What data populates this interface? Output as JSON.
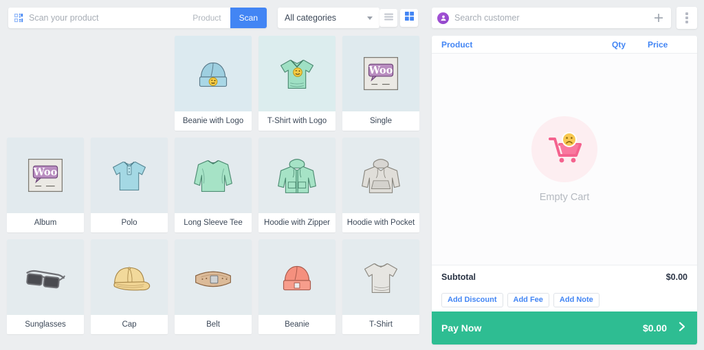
{
  "toolbar": {
    "scan_icon": "barcode-scan-icon",
    "scan_placeholder": "Scan your product",
    "scan_value": "",
    "mode_product_label": "Product",
    "mode_scan_label": "Scan",
    "active_mode": "Scan",
    "category_label": "All categories",
    "caret_icon": "chevron-down-icon",
    "view_list_icon": "list-view-icon",
    "view_grid_icon": "grid-view-icon",
    "active_view": "grid",
    "accent_blue": "#4285f4"
  },
  "customer": {
    "avatar_icon": "user-avatar-icon",
    "search_placeholder": "Search customer",
    "search_value": "",
    "add_icon": "plus-icon",
    "menu_icon": "kebab-menu-icon",
    "avatar_color": "#9b4fd0"
  },
  "products": {
    "rows": [
      [
        {
          "name": "",
          "art": "blank",
          "placeholder": true
        },
        {
          "name": "",
          "art": "blank",
          "placeholder": true
        },
        {
          "name": "Beanie with Logo",
          "art": "beanie-logo"
        },
        {
          "name": "T-Shirt with Logo",
          "art": "tshirt-logo"
        },
        {
          "name": "Single",
          "art": "woo-single"
        }
      ],
      [
        {
          "name": "Album",
          "art": "woo-album"
        },
        {
          "name": "Polo",
          "art": "polo"
        },
        {
          "name": "Long Sleeve Tee",
          "art": "long-sleeve-tee"
        },
        {
          "name": "Hoodie with Zipper",
          "art": "hoodie-zipper"
        },
        {
          "name": "Hoodie with Pocket",
          "art": "hoodie-pocket"
        }
      ],
      [
        {
          "name": "Sunglasses",
          "art": "sunglasses"
        },
        {
          "name": "Cap",
          "art": "cap"
        },
        {
          "name": "Belt",
          "art": "belt"
        },
        {
          "name": "Beanie",
          "art": "beanie"
        },
        {
          "name": "T-Shirt",
          "art": "tshirt"
        }
      ]
    ]
  },
  "cart": {
    "col_product": "Product",
    "col_qty": "Qty",
    "col_price": "Price",
    "empty_icon": "empty-cart-icon",
    "empty_text": "Empty Cart",
    "subtotal_label": "Subtotal",
    "subtotal_value": "$0.00",
    "add_discount_label": "Add Discount",
    "add_fee_label": "Add Fee",
    "add_note_label": "Add Note",
    "pay_label": "Pay Now",
    "pay_amount": "$0.00",
    "pay_arrow_icon": "chevron-right-icon",
    "pay_color": "#2ebd92"
  }
}
